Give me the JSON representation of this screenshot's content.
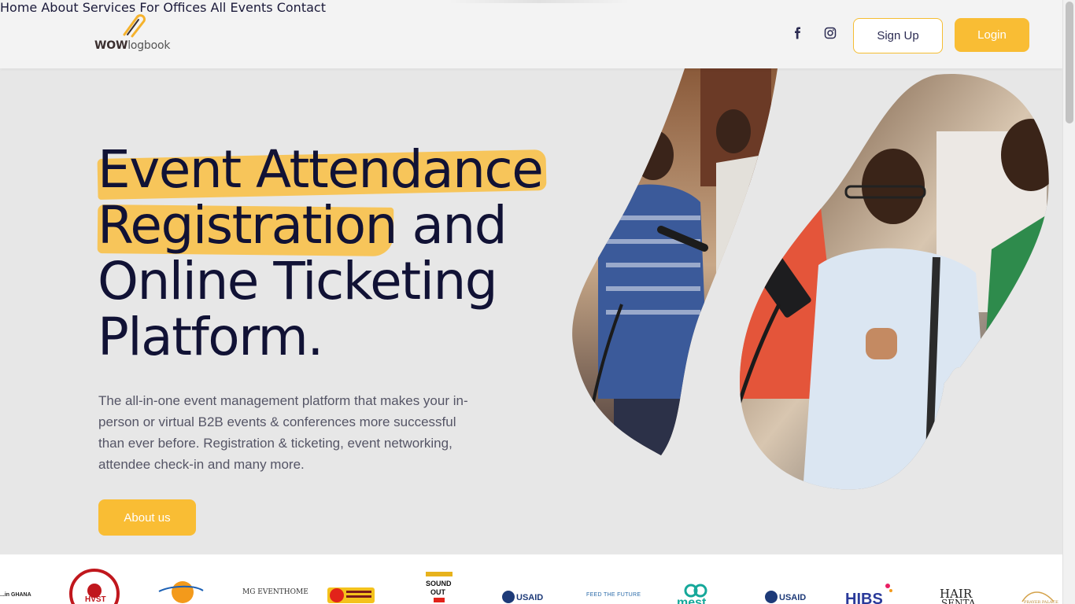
{
  "brand": {
    "logo_wow": "WOW",
    "logo_rest": "logbook"
  },
  "nav": {
    "items": [
      "Home",
      "About",
      "Services",
      "For Offices",
      "All Events",
      "Contact"
    ]
  },
  "social": [
    "facebook-icon",
    "instagram-icon"
  ],
  "buttons": {
    "signup": "Sign Up",
    "login": "Login",
    "about": "About us"
  },
  "hero": {
    "title_lines": [
      "Event Attendance",
      "Registration and",
      "Online Ticketing",
      "Platform."
    ],
    "description": "The all-in-one event management platform that makes your in-person or virtual B2B events & conferences more successful than ever before. Registration & ticketing, event networking, attendee check-in and many more."
  },
  "partners": [
    "HVST",
    "MG EVENTHOME",
    "SOUND OUT",
    "USAID",
    "FEED THE FUTURE",
    "mest",
    "USAID",
    "HIBS",
    "HAIR SENTA"
  ],
  "colors": {
    "accent": "#f9bd34",
    "navy": "#111235",
    "background": "#e7e7e7"
  }
}
